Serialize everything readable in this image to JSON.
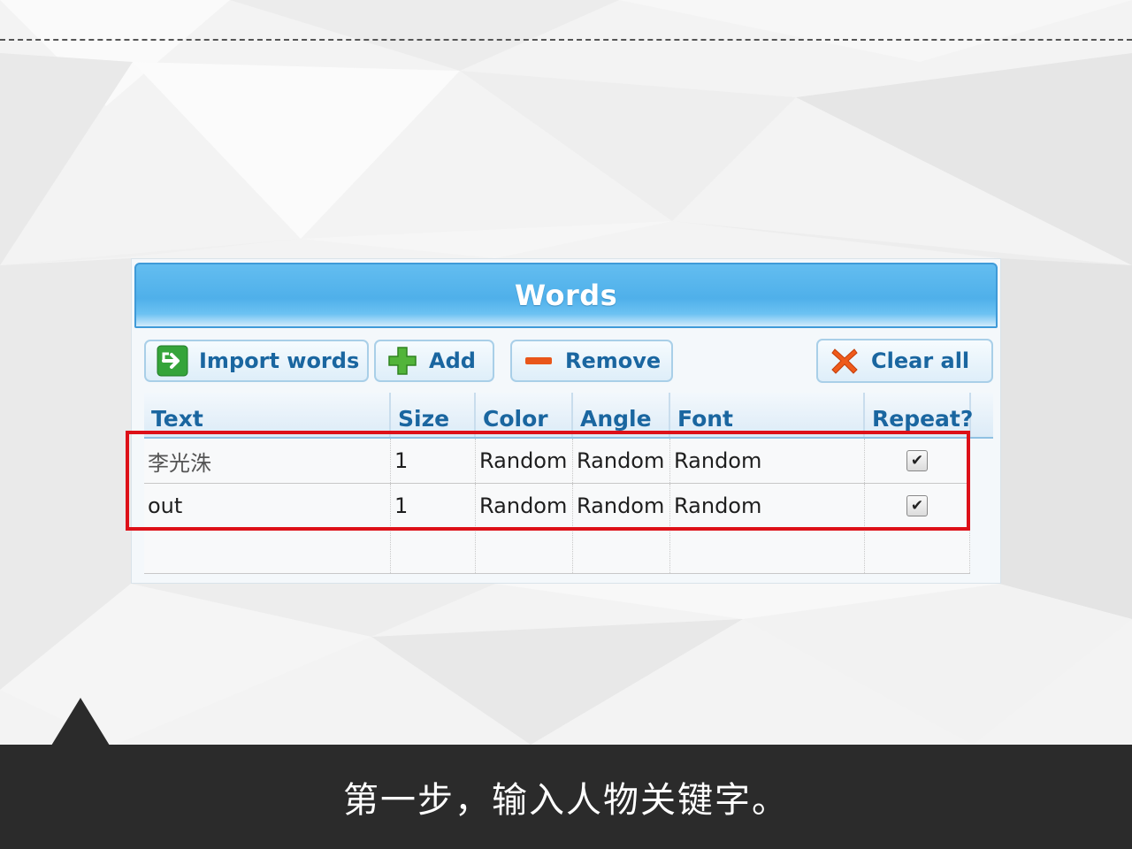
{
  "panel": {
    "title": "Words",
    "buttons": {
      "import": "Import words",
      "add": "Add",
      "remove": "Remove",
      "clear": "Clear all"
    },
    "columns": [
      "Text",
      "Size",
      "Color",
      "Angle",
      "Font",
      "Repeat?"
    ],
    "rows": [
      {
        "text": "李光洙",
        "size": "1",
        "color": "Random",
        "angle": "Random",
        "font": "Random",
        "repeat": true
      },
      {
        "text": "out",
        "size": "1",
        "color": "Random",
        "angle": "Random",
        "font": "Random",
        "repeat": true
      }
    ]
  },
  "caption": "第一步，输入人物关键字。",
  "colors": {
    "accent": "#4fb0ea",
    "button_text": "#1a66a0",
    "highlight": "#dd1018",
    "footer": "#2b2b2b"
  }
}
